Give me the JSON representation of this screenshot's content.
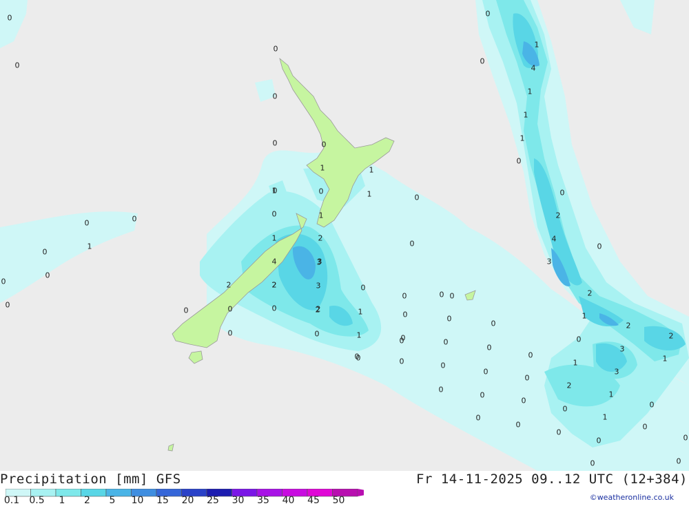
{
  "header": {
    "title": "Precipitation [mm] GFS",
    "valid_time": "Fr 14-11-2025 09..12 UTC (12+384)",
    "credit": "©weatheronline.co.uk"
  },
  "legend": {
    "ticks": [
      "0.1",
      "0.5",
      "1",
      "2",
      "5",
      "10",
      "15",
      "20",
      "25",
      "30",
      "35",
      "40",
      "45",
      "50"
    ],
    "colors": [
      "#cff7f7",
      "#a8f2f2",
      "#7ee8ea",
      "#59d6e6",
      "#4ab4e6",
      "#3f8ee0",
      "#3566d8",
      "#2a42c8",
      "#1c1cb0",
      "#7a16e6",
      "#a812e6",
      "#c80ce0",
      "#e007d6",
      "#b80fb0"
    ]
  },
  "colors": {
    "sea": "#ececec",
    "land": "#c6f5a0",
    "precip_light": "#cff7f7",
    "precip_mid": "#a8f2f2",
    "precip_heavy": "#59d6e6",
    "precip_max": "#4ab4e6"
  },
  "map_labels": [
    "0",
    "0",
    "0",
    "0",
    "0",
    "0",
    "0",
    "0",
    "1",
    "1",
    "0",
    "0",
    "0",
    "1",
    "1",
    "0",
    "0",
    "0",
    "1",
    "0",
    "0",
    "0",
    "0",
    "0",
    "0",
    "0",
    "0",
    "0",
    "0",
    "0",
    "0",
    "0",
    "0",
    "0",
    "0",
    "0",
    "0",
    "0",
    "0",
    "0",
    "0",
    "0",
    "0",
    "0",
    "0",
    "0",
    "0",
    "0",
    "0",
    "0",
    "0",
    "0",
    "1",
    "4",
    "1",
    "1",
    "1",
    "0",
    "0",
    "2",
    "4",
    "3",
    "0",
    "2",
    "1",
    "2",
    "2",
    "3",
    "3",
    "1",
    "1",
    "2",
    "0",
    "1",
    "0",
    "0",
    "0",
    "0",
    "0",
    "0",
    "1",
    "1",
    "1",
    "2",
    "3",
    "2",
    "2",
    "2",
    "4",
    "3",
    "3",
    "2",
    "2",
    "1",
    "1",
    "0",
    "0"
  ]
}
